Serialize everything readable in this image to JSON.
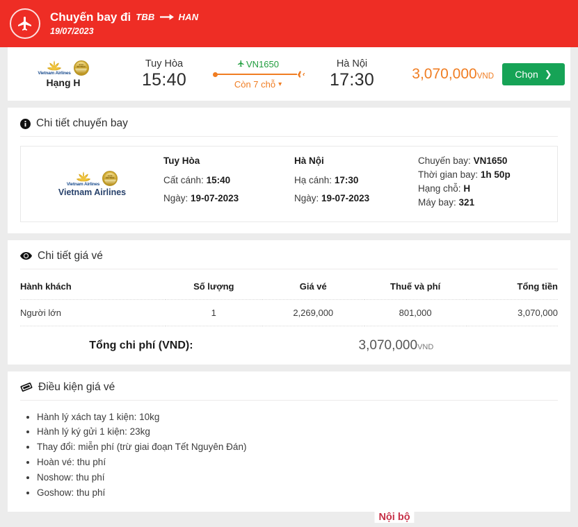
{
  "header": {
    "icon": "airplane-icon",
    "title": "Chuyến bay đi",
    "origin_code": "TBB",
    "arrow_icon": "arrow-right-icon",
    "destination_code": "HAN",
    "date": "19/07/2023",
    "bg_color": "#ee2d25"
  },
  "summary": {
    "airline_logo_name": "vietnam-airlines-logo",
    "airline_name": "Vietnam Airlines",
    "class_label": "Hạng H",
    "departure": {
      "city": "Tuy Hòa",
      "time": "15:40"
    },
    "arrival": {
      "city": "Hà Nội",
      "time": "17:30"
    },
    "flight_number": "VN1650",
    "flight_number_color": "#1f9d3d",
    "seats_left": "Còn 7 chỗ",
    "seats_color": "#f07d22",
    "price": "3,070,000",
    "currency": "VND",
    "price_color": "#f07d22",
    "select_button": "Chọn",
    "select_button_color": "#16a356"
  },
  "flight_detail": {
    "section_title": "Chi tiết chuyến bay",
    "section_icon": "info-circle-icon",
    "airline_name": "Vietnam Airlines",
    "origin": {
      "city": "Tuy Hòa",
      "time_label": "Cất cánh:",
      "time": "15:40",
      "date_label": "Ngày:",
      "date": "19-07-2023"
    },
    "destination": {
      "city": "Hà Nội",
      "time_label": "Hạ cánh:",
      "time": "17:30",
      "date_label": "Ngày:",
      "date": "19-07-2023"
    },
    "info": [
      {
        "label": "Chuyến bay:",
        "value": "VN1650"
      },
      {
        "label": "Thời gian bay:",
        "value": "1h 50p"
      },
      {
        "label": "Hạng chỗ:",
        "value": "H"
      },
      {
        "label": "Máy bay:",
        "value": "321"
      }
    ]
  },
  "fare_detail": {
    "section_title": "Chi tiết giá vé",
    "section_icon": "eye-icon",
    "columns": [
      "Hành khách",
      "Số lượng",
      "Giá vé",
      "Thuế và phí",
      "Tổng tiền"
    ],
    "rows": [
      {
        "passenger": "Người lớn",
        "quantity": "1",
        "base_fare": "2,269,000",
        "taxes_fees": "801,000",
        "total": "3,070,000"
      }
    ],
    "grand_total_label": "Tổng chi phí (VND):",
    "grand_total_value": "3,070,000",
    "grand_total_currency": "VND"
  },
  "fare_rules": {
    "section_title": "Điều kiện giá vé",
    "section_icon": "ticket-tag-icon",
    "items": [
      "Hành lý xách tay 1 kiện: 10kg",
      "Hành lý ký gửi 1 kiện: 23kg",
      "Thay đổi: miễn phí (trừ giai đoạn Tết Nguyên Đán)",
      "Hoàn vé: thu phí",
      "Noshow: thu phí",
      "Goshow: thu phí"
    ]
  },
  "footer": {
    "label": "Nội bộ",
    "color": "#c63047"
  }
}
